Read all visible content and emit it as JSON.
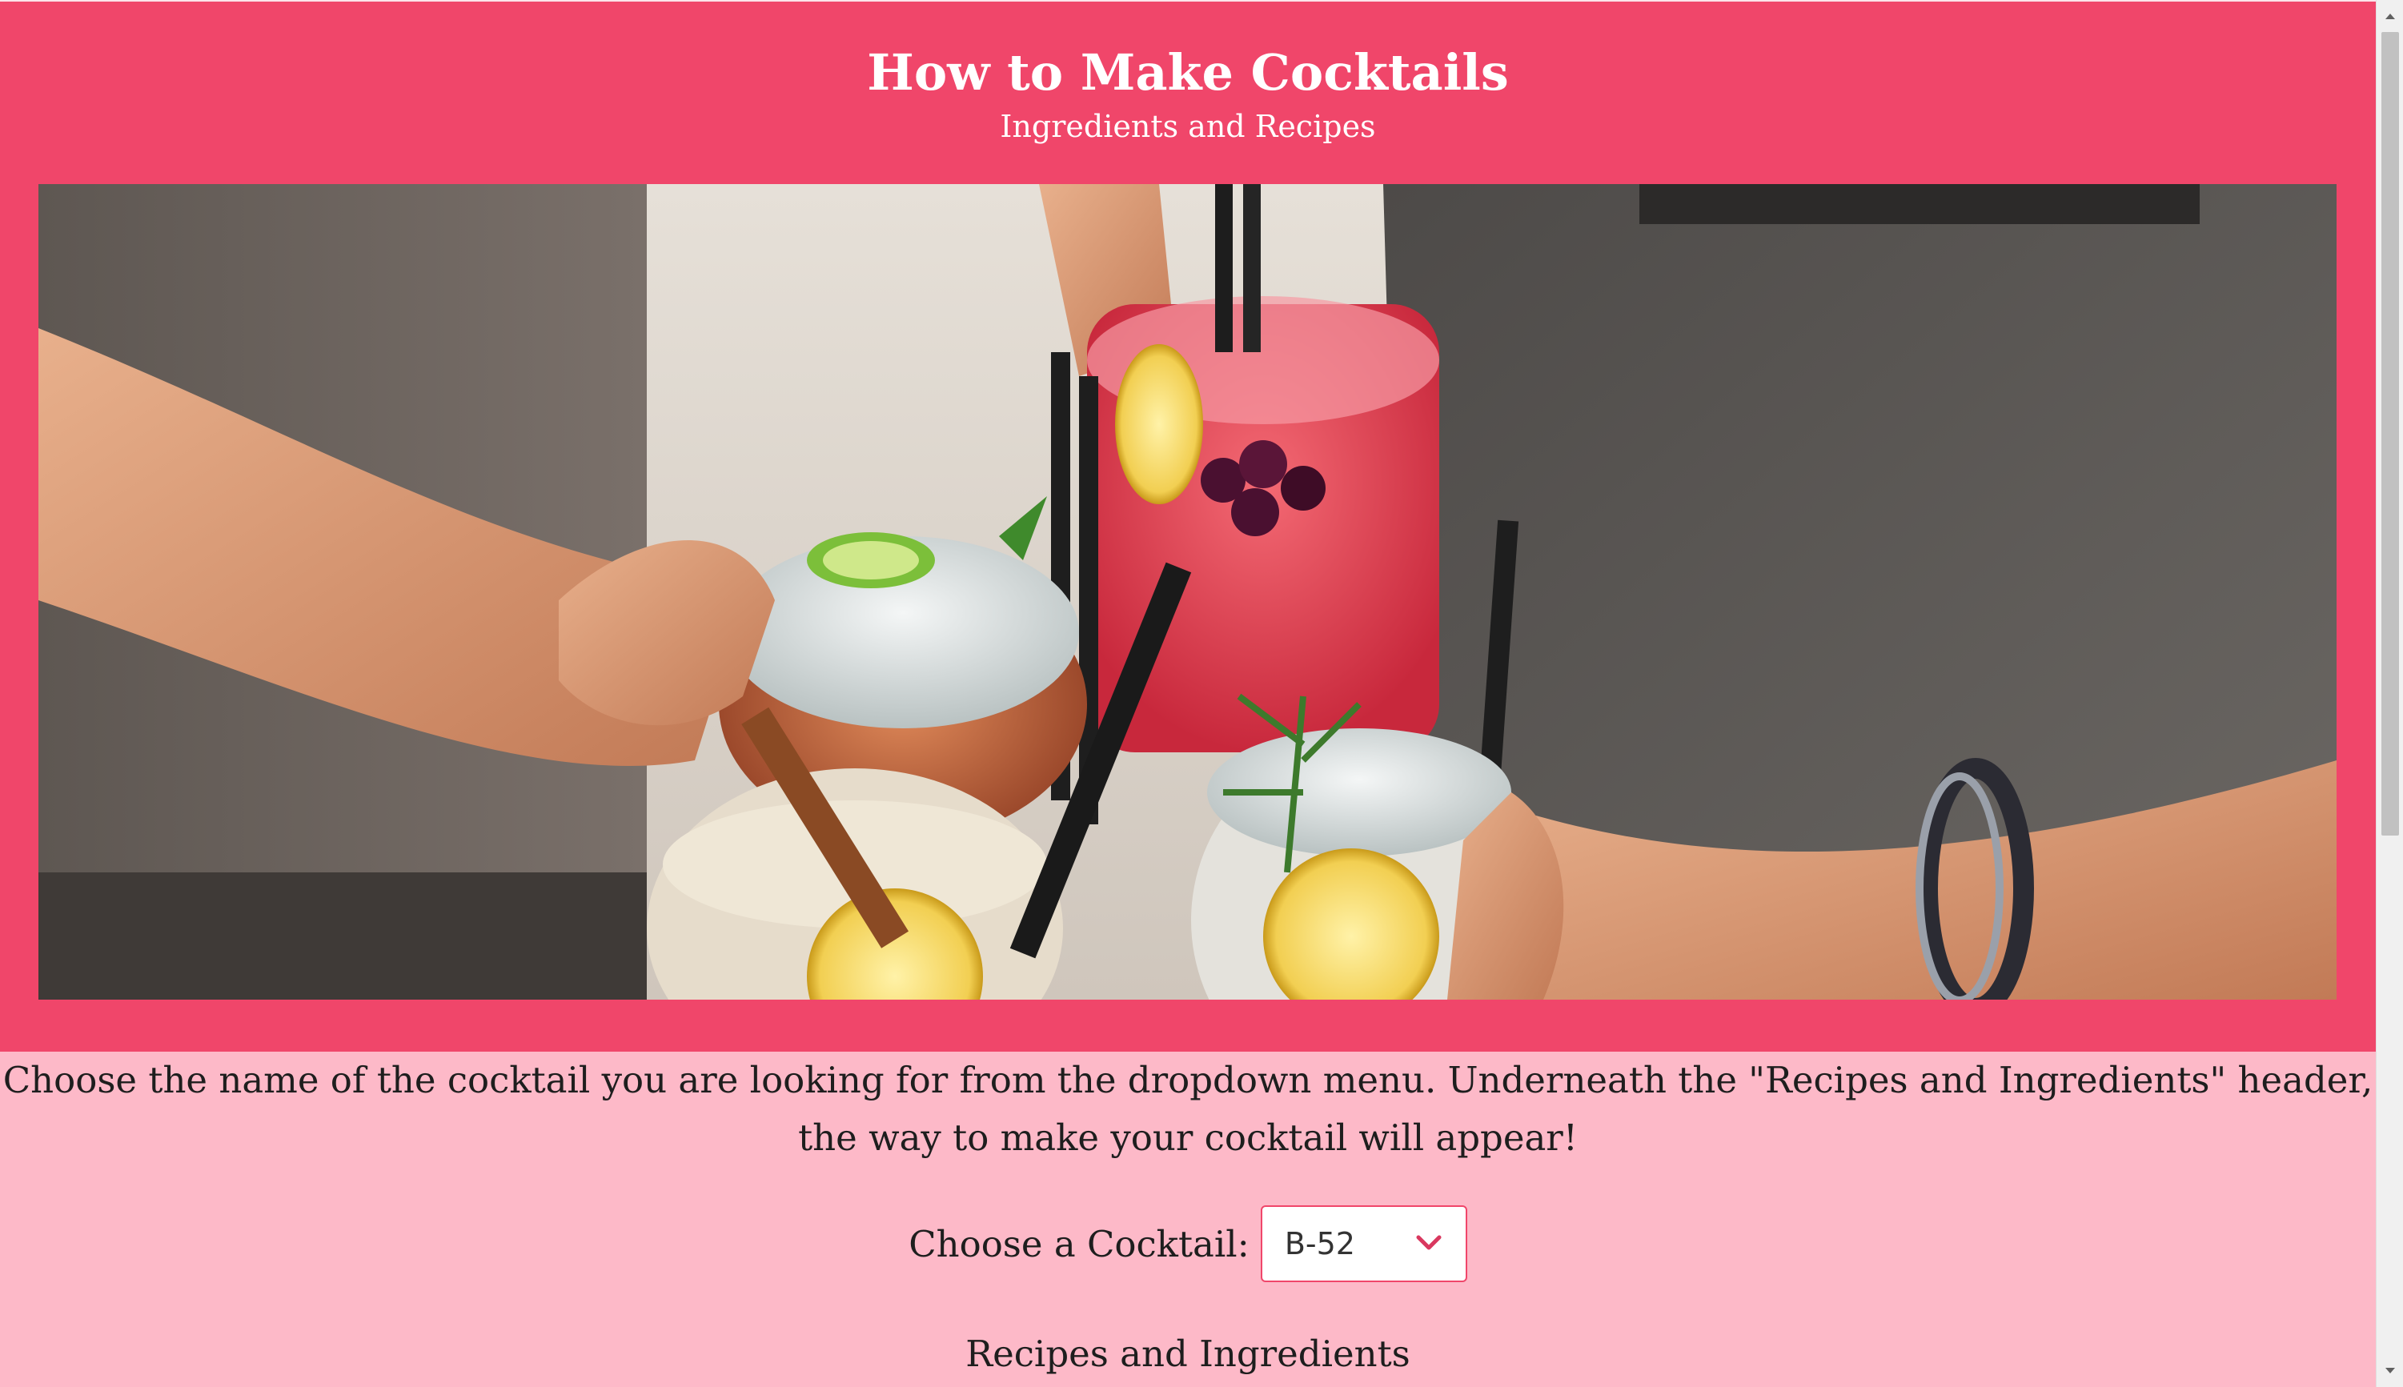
{
  "header": {
    "title": "How to Make Cocktails",
    "subtitle": "Ingredients and Recipes"
  },
  "hero": {
    "alt": "Hands toasting with colorful cocktails"
  },
  "intro": {
    "text": "Choose the name of the cocktail you are looking for from the dropdown menu. Underneath the \"Recipes and Ingredients\" header, the way to make your cocktail will appear!"
  },
  "chooser": {
    "label": "Choose a Cocktail:",
    "selected": "B-52",
    "icon": "chevron-down-icon"
  },
  "recipes": {
    "heading": "Recipes and Ingredients"
  },
  "colors": {
    "header_bg": "#f0466a",
    "page_bg": "#fdb9c8",
    "accent": "#d9385f"
  }
}
